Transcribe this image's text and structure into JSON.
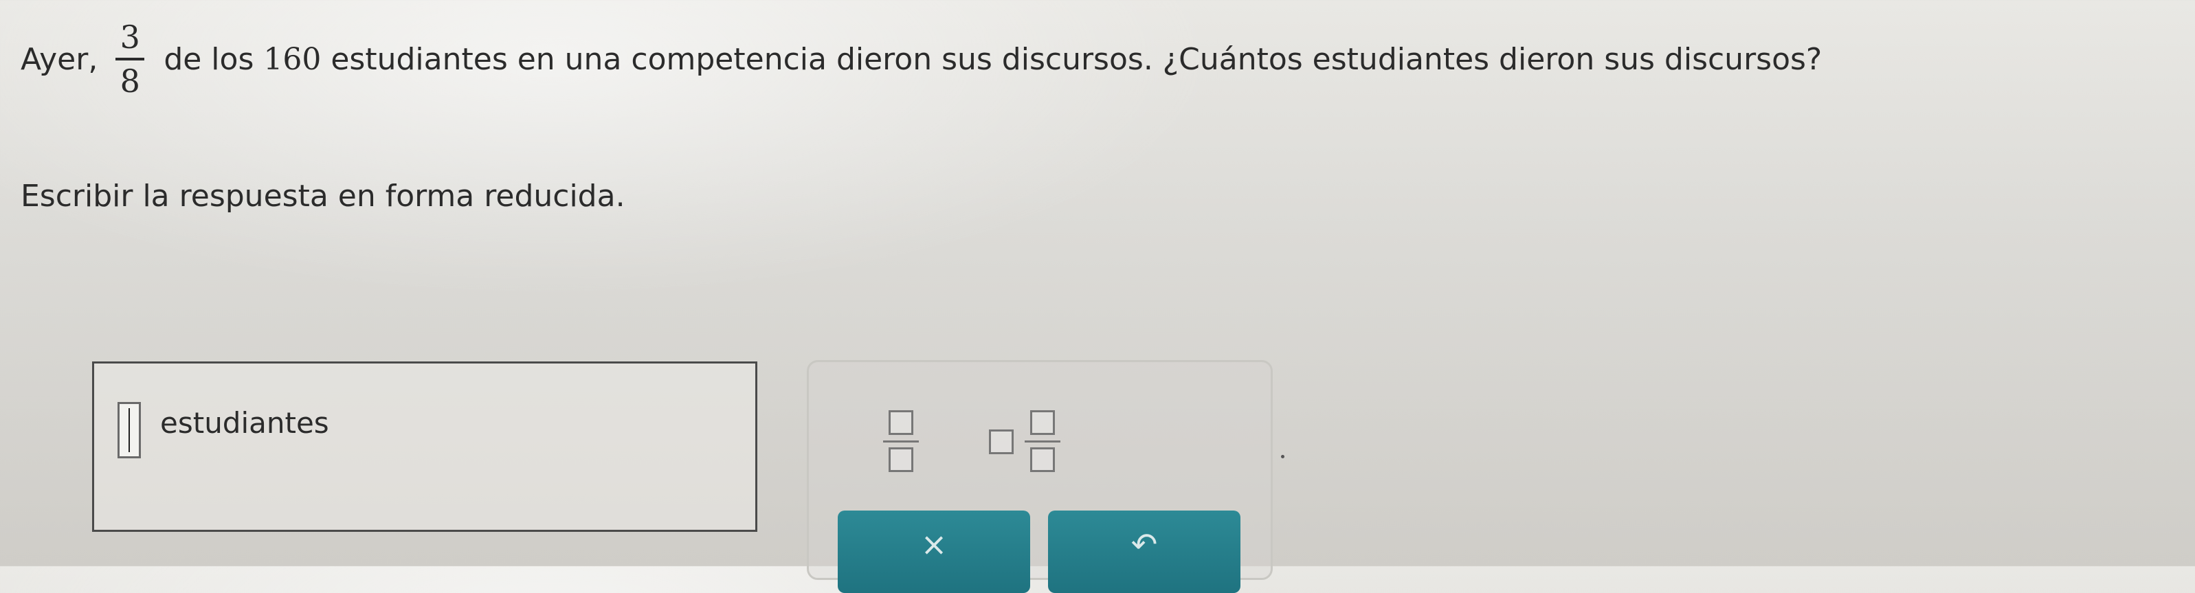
{
  "question": {
    "prefix": "Ayer,",
    "fraction_numerator": "3",
    "fraction_denominator": "8",
    "middle": "de los",
    "number": "160",
    "suffix": "estudiantes en una competencia dieron sus discursos. ¿Cuántos estudiantes dieron sus discursos?"
  },
  "instruction": "Escribir la respuesta en forma reducida.",
  "answer": {
    "value": "",
    "unit_label": "estudiantes"
  },
  "tools": {
    "fraction_icon": "fraction-template-icon",
    "mixed_number_icon": "mixed-number-template-icon",
    "clear_label": "×",
    "undo_label": "↶"
  }
}
